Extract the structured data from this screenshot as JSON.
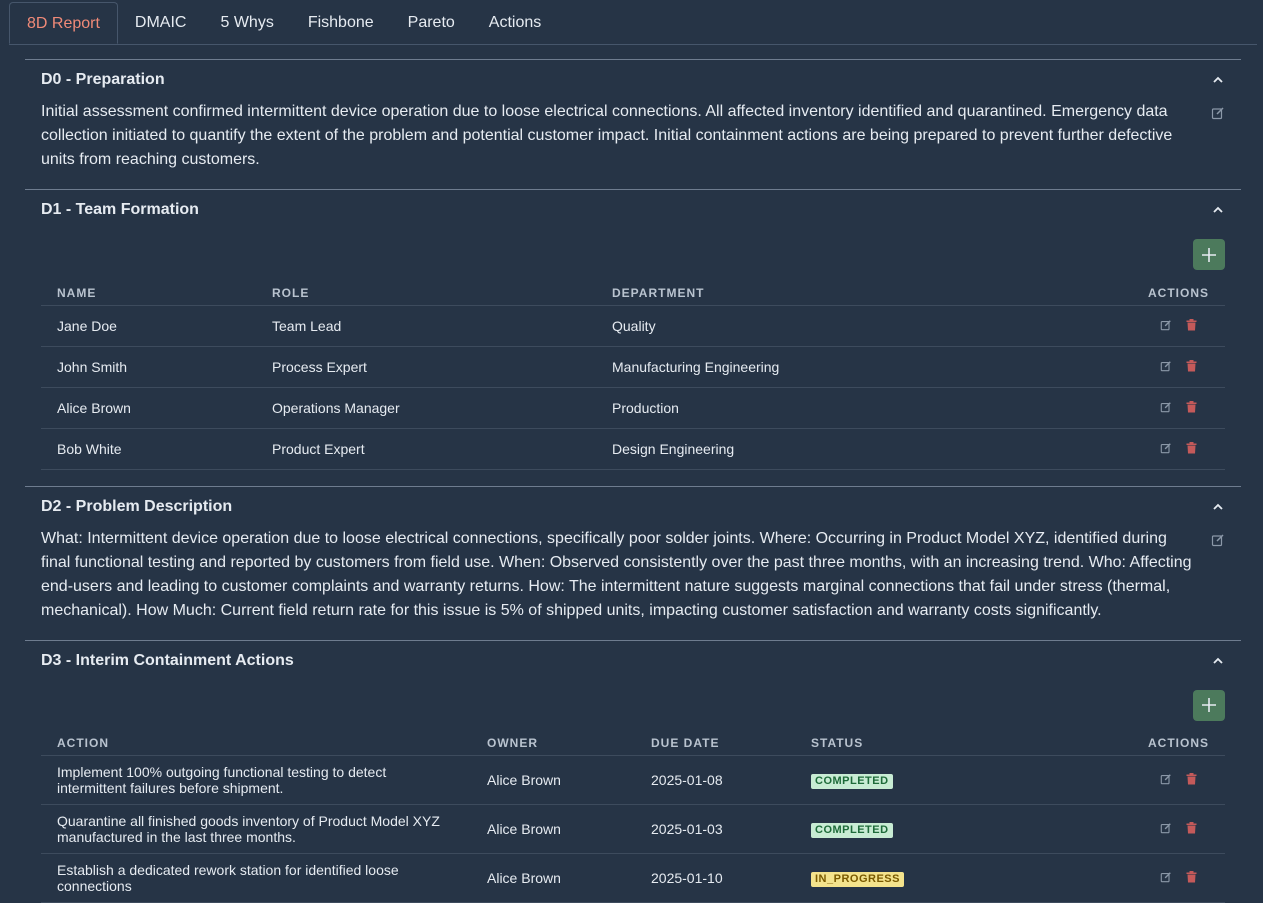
{
  "tabs": [
    "8D Report",
    "DMAIC",
    "5 Whys",
    "Fishbone",
    "Pareto",
    "Actions"
  ],
  "active_tab": 0,
  "d0": {
    "title": "D0 - Preparation",
    "text": "Initial assessment confirmed intermittent device operation due to loose electrical connections. All affected inventory identified and quarantined. Emergency data collection initiated to quantify the extent of the problem and potential customer impact. Initial containment actions are being prepared to prevent further defective units from reaching customers."
  },
  "d1": {
    "title": "D1 - Team Formation",
    "headers": [
      "NAME",
      "ROLE",
      "DEPARTMENT",
      "ACTIONS"
    ],
    "rows": [
      {
        "name": "Jane Doe",
        "role": "Team Lead",
        "department": "Quality"
      },
      {
        "name": "John Smith",
        "role": "Process Expert",
        "department": "Manufacturing Engineering"
      },
      {
        "name": "Alice Brown",
        "role": "Operations Manager",
        "department": "Production"
      },
      {
        "name": "Bob White",
        "role": "Product Expert",
        "department": "Design Engineering"
      }
    ]
  },
  "d2": {
    "title": "D2 - Problem Description",
    "text": "What: Intermittent device operation due to loose electrical connections, specifically poor solder joints. Where: Occurring in Product Model XYZ, identified during final functional testing and reported by customers from field use. When: Observed consistently over the past three months, with an increasing trend. Who: Affecting end-users and leading to customer complaints and warranty returns. How: The intermittent nature suggests marginal connections that fail under stress (thermal, mechanical). How Much: Current field return rate for this issue is 5% of shipped units, impacting customer satisfaction and warranty costs significantly."
  },
  "d3": {
    "title": "D3 - Interim Containment Actions",
    "headers": [
      "ACTION",
      "OWNER",
      "DUE DATE",
      "STATUS",
      "ACTIONS"
    ],
    "rows": [
      {
        "action": "Implement 100% outgoing functional testing to detect intermittent failures before shipment.",
        "owner": "Alice Brown",
        "due": "2025-01-08",
        "status": "COMPLETED",
        "status_kind": "done"
      },
      {
        "action": "Quarantine all finished goods inventory of Product Model XYZ manufactured in the last three months.",
        "owner": "Alice Brown",
        "due": "2025-01-03",
        "status": "COMPLETED",
        "status_kind": "done"
      },
      {
        "action": "Establish a dedicated rework station for identified loose connections",
        "owner": "Alice Brown",
        "due": "2025-01-10",
        "status": "IN_PROGRESS",
        "status_kind": "prog"
      }
    ]
  },
  "colors": {
    "accent": "#f08a78",
    "add_button": "#4c7a5c",
    "background": "#263446"
  },
  "icons": {
    "collapse": "chevron-up-icon",
    "edit": "edit-icon",
    "delete": "trash-icon",
    "add": "plus-icon"
  }
}
